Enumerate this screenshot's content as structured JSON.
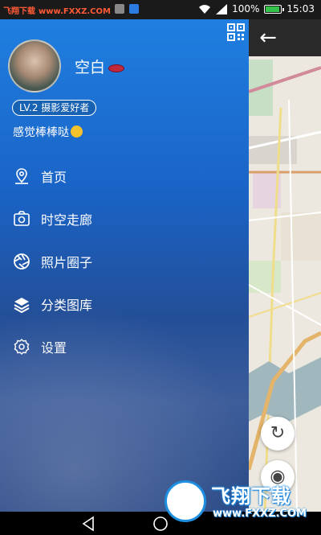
{
  "status_bar": {
    "site_name": "飞翔下载",
    "site_url": "www.FXXZ.COM",
    "battery": "100%",
    "time": "15:03"
  },
  "drawer": {
    "username": "空白",
    "level_badge": "LV.2 摄影爱好者",
    "status_text": "感觉棒棒哒",
    "menu": [
      {
        "label": "首页",
        "icon": "location-pin-icon"
      },
      {
        "label": "时空走廊",
        "icon": "camera-icon"
      },
      {
        "label": "照片圈子",
        "icon": "aperture-icon"
      },
      {
        "label": "分类图库",
        "icon": "layers-icon"
      },
      {
        "label": "设置",
        "icon": "gear-icon"
      }
    ]
  },
  "watermark": {
    "title": "飞翔下载",
    "url": "www.FXXZ.COM"
  },
  "colors": {
    "drawer_top": "#1f7fe0",
    "drawer_bottom": "#2a4a86",
    "map_bg": "#ece8df"
  }
}
